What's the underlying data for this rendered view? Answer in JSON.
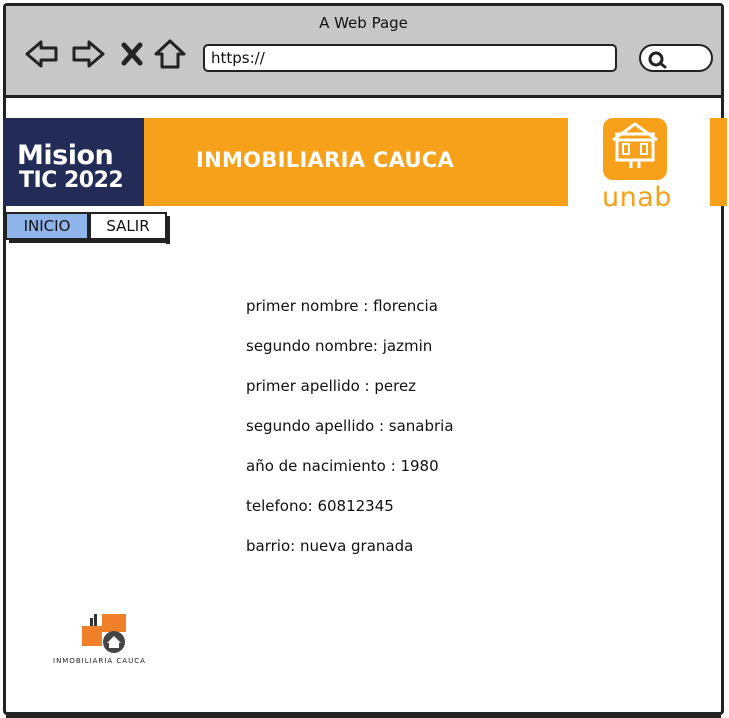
{
  "browser": {
    "title": "A Web Page",
    "url": "https://"
  },
  "header": {
    "mision_line1": "Mision",
    "mision_line2": "TIC 2022",
    "title": "INMOBILIARIA CAUCA",
    "unab": "unab",
    "colors": {
      "brand_orange": "#f7a11a",
      "mision_navy": "#232c57",
      "tab_active": "#8fb4ea"
    }
  },
  "nav": {
    "items": [
      {
        "label": "INICIO",
        "active": true
      },
      {
        "label": "SALIR",
        "active": false
      }
    ]
  },
  "details": [
    "primer nombre : florencia",
    "segundo nombre: jazmin",
    "primer apellido : perez",
    "segundo apellido : sanabria",
    "año de nacimiento : 1980",
    "telefono: 60812345",
    "barrio: nueva granada"
  ],
  "footer": {
    "logo_text": "INMOBILIARIA CAUCA"
  }
}
